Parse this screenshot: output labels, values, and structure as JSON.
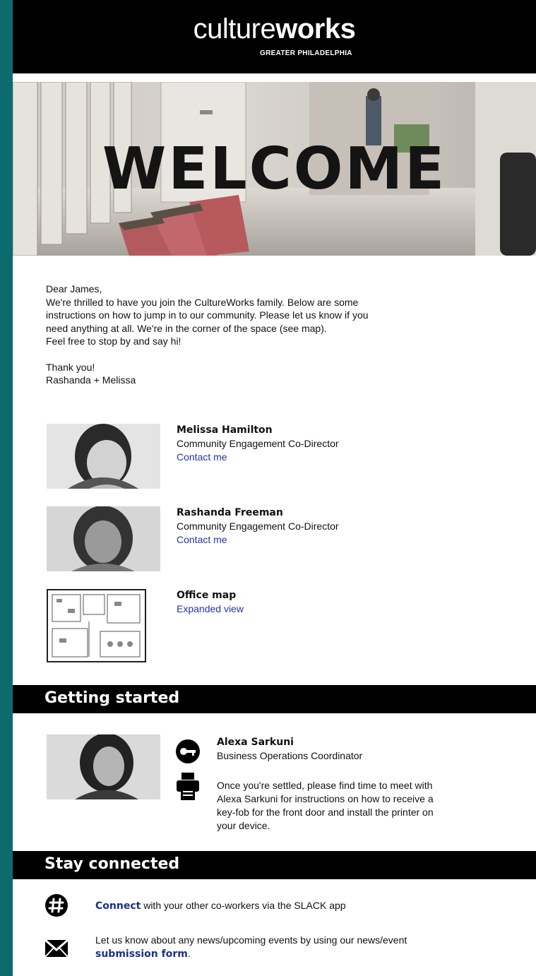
{
  "header": {
    "logo_light": "culture",
    "logo_bold": "works",
    "logo_sub": "GREATER PHILADELPHIA"
  },
  "hero": {
    "title": "WELCOME"
  },
  "letter": {
    "greeting": "Dear James,",
    "line1": "We're thrilled to have you join the CultureWorks family.  Below are some",
    "line2": "instructions on how to jump in to our community.  Please let us know if you",
    "line3": "need anything at all.  We're in the corner of the space (see map).",
    "line4": "Feel free to stop by and say hi!",
    "thanks": "Thank you!",
    "signature": "Rashanda + Melissa"
  },
  "people": [
    {
      "name": "Melissa Hamilton",
      "title": "Community Engagement Co-Director",
      "link": "Contact me"
    },
    {
      "name": "Rashanda Freeman",
      "title": "Community Engagement Co-Director",
      "link": "Contact me"
    }
  ],
  "map": {
    "title": "Office map",
    "link": "Expanded view"
  },
  "getting_started": {
    "heading": "Getting started",
    "name": "Alexa Sarkuni",
    "title": "Business Operations Coordinator",
    "text1": "Once you're settled, please find time to meet with",
    "text2": "Alexa Sarkuni for instructions on how to receive a",
    "text3": "key-fob for the front door and install the printer on",
    "text4": "your device."
  },
  "stay_connected": {
    "heading": "Stay connected",
    "connect_link": "Connect",
    "connect_text": " with your other co-workers via the SLACK app",
    "news_text": "Let us know about any news/upcoming events by using our news/event",
    "submission_link": "submission form",
    "period": "."
  },
  "colors": {
    "page_bg": "#0d6b6e",
    "link": "#2233aa",
    "bar": "#000000"
  },
  "icons": [
    "key-icon",
    "printer-icon",
    "slack-hashtag-icon",
    "envelope-icon"
  ]
}
